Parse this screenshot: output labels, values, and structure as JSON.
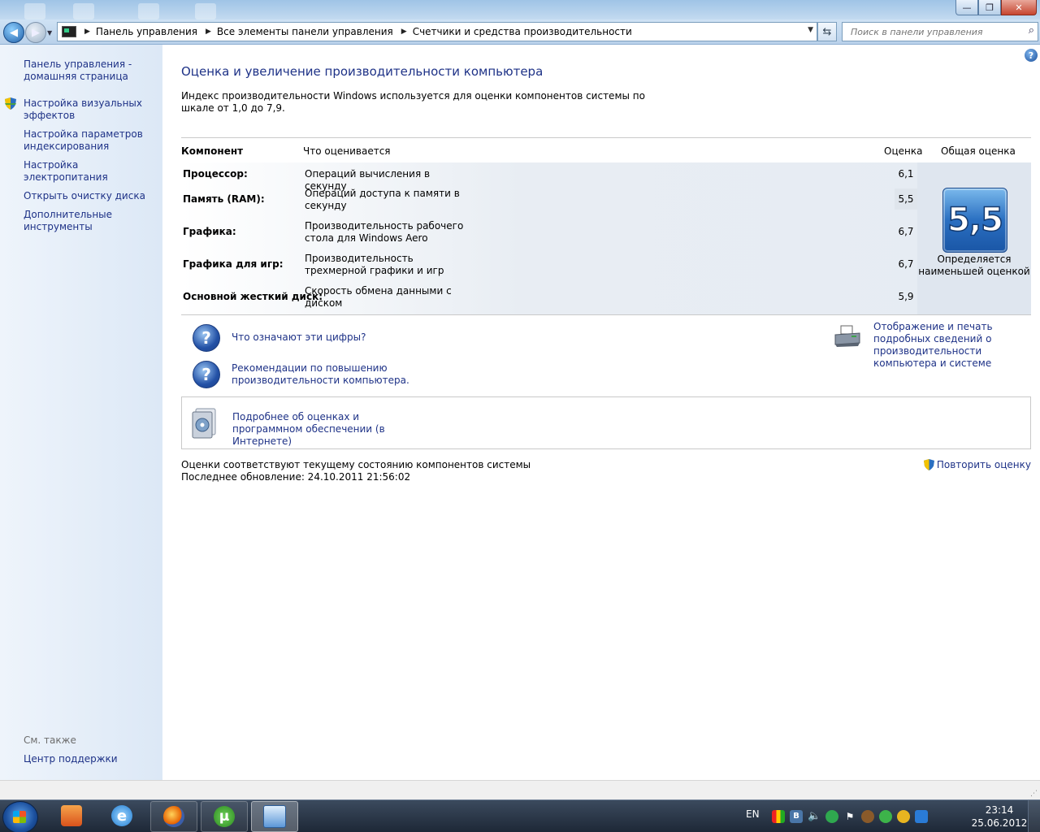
{
  "window": {
    "minimize": "—",
    "maximize": "❐",
    "close": "✕"
  },
  "nav": {
    "back_icon": "arrow-left-icon",
    "forward_icon": "arrow-right-icon",
    "breadcrumbs": [
      "Панель управления",
      "Все элементы панели управления",
      "Счетчики и средства производительности"
    ],
    "search_placeholder": "Поиск в панели управления"
  },
  "sidebar": {
    "home": "Панель управления - домашняя страница",
    "items": [
      "Настройка визуальных эффектов",
      "Настройка параметров индексирования",
      "Настройка электропитания",
      "Открыть очистку диска",
      "Дополнительные инструменты"
    ],
    "see_also_label": "См. также",
    "see_also_link": "Центр поддержки"
  },
  "main": {
    "title": "Оценка и увеличение производительности компьютера",
    "description": "Индекс производительности Windows используется для оценки компонентов системы по шкале от 1,0 до 7,9.",
    "headers": {
      "component": "Компонент",
      "what": "Что оценивается",
      "score": "Оценка",
      "overall": "Общая оценка"
    },
    "rows": [
      {
        "component": "Процессор:",
        "what": "Операций вычисления в секунду",
        "score": "6,1"
      },
      {
        "component": "Память (RAM):",
        "what": "Операций доступа к памяти в секунду",
        "score": "5,5"
      },
      {
        "component": "Графика:",
        "what": "Производительность рабочего стола для Windows Aero",
        "score": "6,7"
      },
      {
        "component": "Графика для игр:",
        "what": "Производительность трехмерной графики и игр",
        "score": "6,7"
      },
      {
        "component": "Основной жесткий диск:",
        "what": "Скорость обмена данными с диском",
        "score": "5,9"
      }
    ],
    "overall_score": "5,5",
    "overall_note": "Определяется наименьшей оценкой",
    "links": {
      "what_numbers": "Что означают эти цифры?",
      "recommendations": "Рекомендации по повышению производительности компьютера.",
      "print_details": "Отображение и печать подробных сведений о производительности компьютера и системе",
      "more_info": "Подробнее об оценках и программном обеспечении (в Интернете)"
    },
    "status_line1": "Оценки соответствуют текущему состоянию компонентов системы",
    "status_line2": "Последнее обновление: 24.10.2011 21:56:02",
    "repeat": "Повторить оценку"
  },
  "taskbar": {
    "lang": "EN",
    "time": "23:14",
    "date": "25.06.2012"
  },
  "colors": {
    "link": "#1e3287",
    "sidebar_bg": "#dce8f6",
    "badge": "#2a6fc1"
  }
}
